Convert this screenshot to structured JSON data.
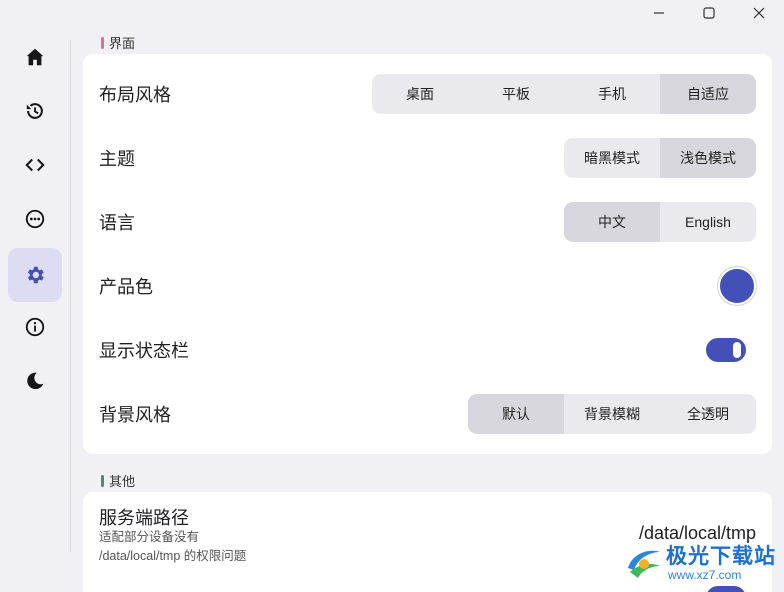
{
  "window": {
    "controls": [
      "minimize",
      "maximize",
      "close"
    ]
  },
  "sidebar": {
    "items": [
      {
        "icon": "home-icon"
      },
      {
        "icon": "history-icon"
      },
      {
        "icon": "code-icon"
      },
      {
        "icon": "more-icon"
      },
      {
        "icon": "gear-icon",
        "active": true
      },
      {
        "icon": "info-icon"
      },
      {
        "icon": "moon-icon"
      }
    ]
  },
  "colors": {
    "accent": "#4250b8",
    "product_color": "#4250b8",
    "interface_marker": "#e07088",
    "other_marker": "#3f8f7a"
  },
  "interface": {
    "title": "界面",
    "layout": {
      "label": "布局风格",
      "options": [
        "桌面",
        "平板",
        "手机",
        "自适应"
      ],
      "selected": "自适应"
    },
    "theme": {
      "label": "主题",
      "options": [
        "暗黑模式",
        "浅色模式"
      ],
      "selected": "浅色模式"
    },
    "language": {
      "label": "语言",
      "options": [
        "中文",
        "English"
      ],
      "selected": "中文"
    },
    "product_color": {
      "label": "产品色"
    },
    "statusbar": {
      "label": "显示状态栏",
      "on": true
    },
    "background": {
      "label": "背景风格",
      "options": [
        "默认",
        "背景模糊",
        "全透明"
      ],
      "selected": "默认"
    }
  },
  "other": {
    "title": "其他",
    "server_path": {
      "label": "服务端路径",
      "desc1": "适配部分设备没有",
      "desc2": "/data/local/tmp 的权限问题",
      "value": "/data/local/tmp"
    }
  },
  "watermark": {
    "text": "极光下载站",
    "url": "www.xz7.com"
  }
}
